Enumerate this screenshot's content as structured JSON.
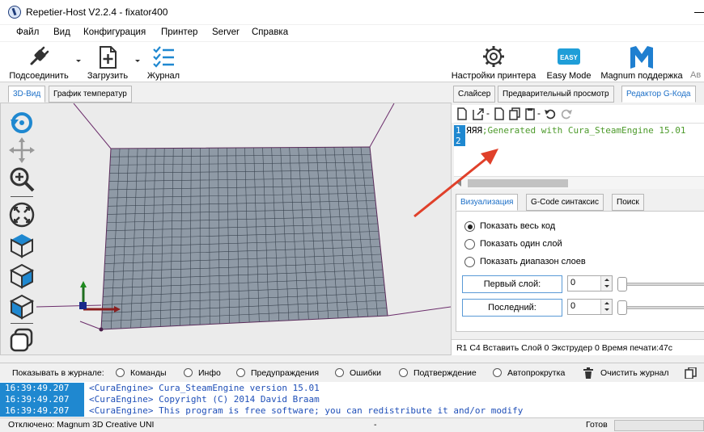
{
  "window": {
    "title": "Repetier-Host V2.2.4 - fixator400"
  },
  "menu": [
    "Файл",
    "Вид",
    "Конфигурация",
    "Принтер",
    "Server",
    "Справка"
  ],
  "toolbar": {
    "connect": "Подсоединить",
    "load": "Загрузить",
    "log": "Журнал",
    "printer_settings": "Настройки принтера",
    "easy_mode": "Easy Mode",
    "easy_badge": "EASY",
    "magnum_support": "Magnum поддержка",
    "cut_label": "Ав"
  },
  "left_tabs": [
    "3D-Вид",
    "График температур"
  ],
  "right_tabs": [
    "Слайсер",
    "Предварительный просмотр",
    "Редактор G-Кода"
  ],
  "editor": {
    "lines": [
      "1",
      "2"
    ],
    "line1_text": "ЯЯЯ",
    "line1_comment": ";Generated with Cura_SteamEngine 15.01"
  },
  "viz_tabs": [
    "Визуализация",
    "G-Code синтаксис",
    "Поиск"
  ],
  "viz": {
    "show_all": "Показать весь код",
    "show_one": "Показать один слой",
    "show_range": "Показать диапазон слоев",
    "first_layer_label": "Первый слой:",
    "first_layer_value": "0",
    "last_layer_label": "Последний:",
    "last_layer_value": "0"
  },
  "gcode_status": "R1  C4  Вставить  Слой 0  Экструдер 0  Время печати:47с",
  "log_filter": {
    "label": "Показывать в журнале:",
    "options": [
      "Команды",
      "Инфо",
      "Предупраждения",
      "Ошибки",
      "Подтверждение",
      "Автопрокрутка"
    ],
    "clear": "Очистить журнал"
  },
  "log": [
    {
      "time": "16:39:49.207",
      "msg": "<CuraEngine> Cura_SteamEngine version 15.01"
    },
    {
      "time": "16:39:49.207",
      "msg": "<CuraEngine> Copyright (C) 2014 David Braam"
    },
    {
      "time": "16:39:49.207",
      "msg": "<CuraEngine> This program is free software; you can redistribute it and/or modify"
    }
  ],
  "status": {
    "connection": "Отключено: Magnum 3D Creative UNI",
    "middle": "-",
    "ready": "Готов"
  },
  "colors": {
    "accent": "#1f88d0",
    "grid": "#8f9aa6",
    "comment": "#4c9a2a",
    "arrow": "#e0402a"
  }
}
